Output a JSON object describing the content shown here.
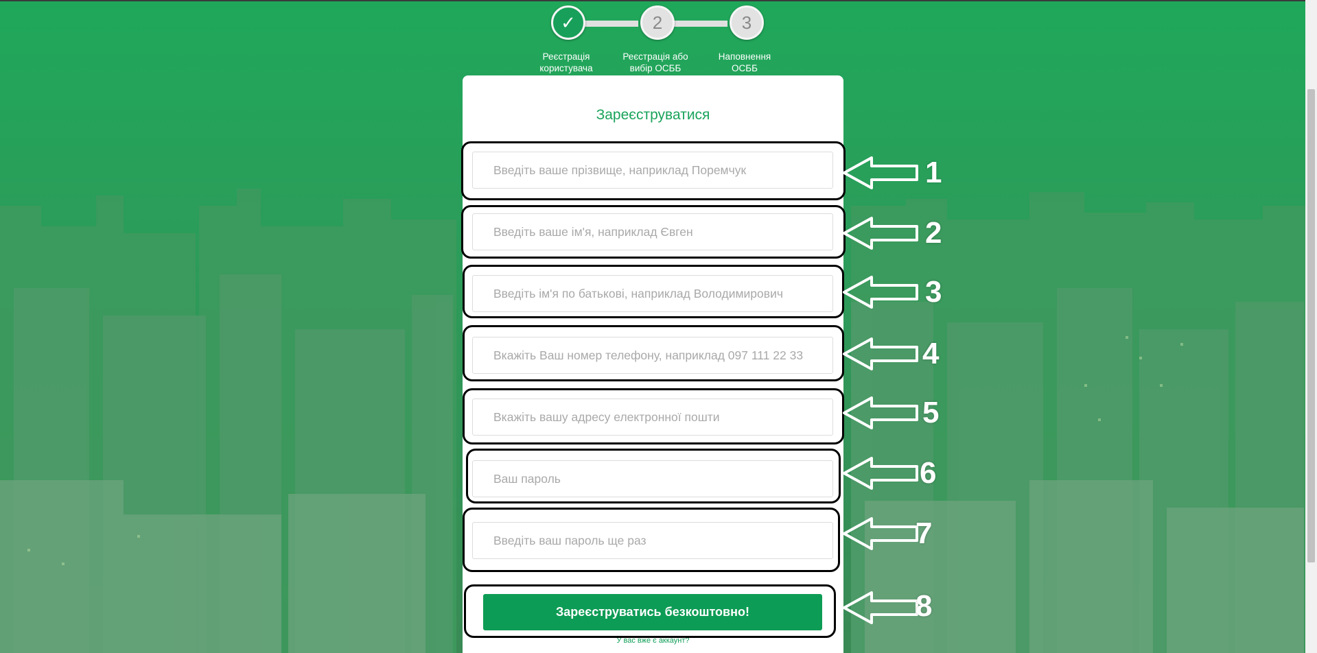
{
  "colors": {
    "brand_green": "#19a35a",
    "button_green": "#0d9c55",
    "background_overlay": "#2a9a58"
  },
  "steps": [
    {
      "number": "",
      "label_line1": "Реєстрація",
      "label_line2": "користувача",
      "status": "done",
      "icon": "check-icon"
    },
    {
      "number": "2",
      "label_line1": "Реєстрація або",
      "label_line2": "вибір ОСББ",
      "status": "pending"
    },
    {
      "number": "3",
      "label_line1": "Наповнення",
      "label_line2": "ОСББ",
      "status": "pending"
    }
  ],
  "form": {
    "title": "Зареєструватися",
    "fields": [
      {
        "placeholder": "Введіть ваше прізвище, наприклад Поремчук",
        "value": ""
      },
      {
        "placeholder": "Введіть ваше ім'я, наприклад Євген",
        "value": ""
      },
      {
        "placeholder": "Введіть ім'я по батькові, наприклад Володимирович",
        "value": ""
      },
      {
        "placeholder": "Вкажіть Ваш номер телефону, наприклад 097 111 22 33",
        "value": ""
      },
      {
        "placeholder": "Вкажіть вашу адресу електронної пошти",
        "value": ""
      },
      {
        "placeholder": "Ваш пароль",
        "value": ""
      },
      {
        "placeholder": "Введіть ваш пароль ще раз",
        "value": ""
      }
    ],
    "submit_label": "Зареєструватись безкоштовно!",
    "login_link": "У вас вже є аккаунт?"
  },
  "annotations": [
    "1",
    "2",
    "3",
    "4",
    "5",
    "6",
    "7",
    "8"
  ]
}
